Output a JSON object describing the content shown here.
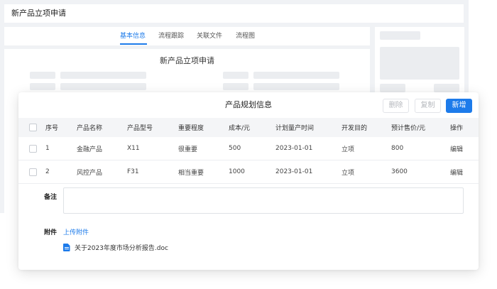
{
  "page_title": "新产品立项申请",
  "tabs": [
    {
      "label": "基本信息",
      "active": true
    },
    {
      "label": "流程跟踪",
      "active": false
    },
    {
      "label": "关联文件",
      "active": false
    },
    {
      "label": "流程图",
      "active": false
    }
  ],
  "form_title": "新产品立项申请",
  "dialog": {
    "title": "产品规划信息",
    "buttons": {
      "delete": "删除",
      "copy": "复制",
      "add": "新增"
    },
    "columns": [
      "序号",
      "产品名称",
      "产品型号",
      "重要程度",
      "成本/元",
      "计划量产时间",
      "开发目的",
      "预计售价/元",
      "操作"
    ],
    "rows": [
      {
        "index": "1",
        "name": "金融产品",
        "model": "X11",
        "importance": "很重要",
        "cost": "500",
        "date": "2023-01-01",
        "purpose": "立项",
        "price": "800",
        "action": "编辑"
      },
      {
        "index": "2",
        "name": "风控产品",
        "model": "F31",
        "importance": "相当重要",
        "cost": "1000",
        "date": "2023-01-01",
        "purpose": "立项",
        "price": "3600",
        "action": "编辑"
      }
    ],
    "remark_label": "备注",
    "remark_value": "",
    "attachment_label": "附件",
    "upload_label": "上传附件",
    "attachments": [
      {
        "name": "关于2023年度市场分析报告.doc",
        "icon": "doc-file-icon"
      }
    ]
  },
  "colors": {
    "accent": "#1d7bea",
    "background": "#f0f2f5",
    "header_bg": "#f4f5f7"
  }
}
